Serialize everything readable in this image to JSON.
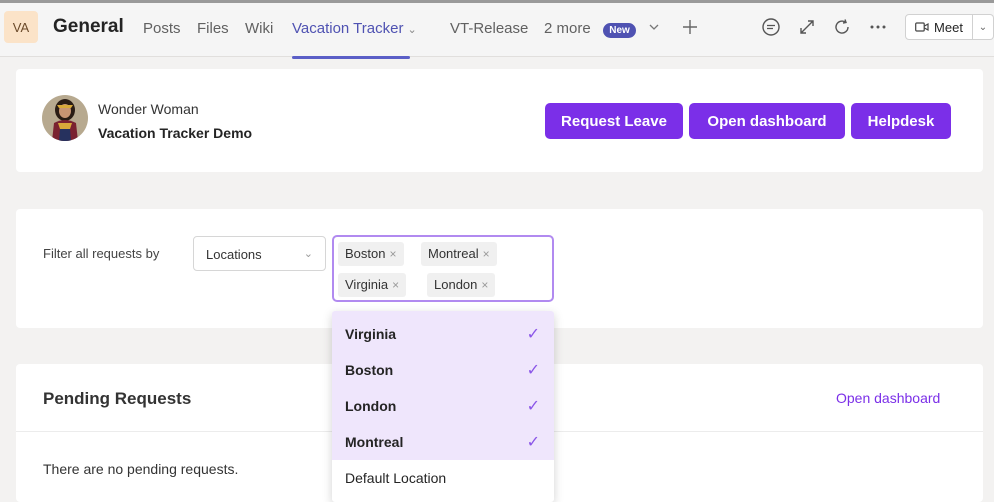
{
  "header": {
    "avatar_initials": "VA",
    "team_title": "General",
    "tabs": [
      {
        "label": "Posts"
      },
      {
        "label": "Files"
      },
      {
        "label": "Wiki"
      },
      {
        "label": "Vacation Tracker"
      },
      {
        "label": "VT-Release"
      },
      {
        "label": "2 more"
      }
    ],
    "new_badge": "New",
    "meet_label": "Meet"
  },
  "profile": {
    "user_name": "Wonder Woman",
    "app_name": "Vacation Tracker Demo"
  },
  "actions": {
    "request_leave": "Request Leave",
    "open_dashboard": "Open dashboard",
    "helpdesk": "Helpdesk"
  },
  "filter": {
    "label": "Filter all requests by",
    "select_value": "Locations",
    "selected_tags": [
      "Boston",
      "Montreal",
      "Virginia",
      "London"
    ],
    "options": [
      {
        "label": "Virginia",
        "selected": true
      },
      {
        "label": "Boston",
        "selected": true
      },
      {
        "label": "London",
        "selected": true
      },
      {
        "label": "Montreal",
        "selected": true
      },
      {
        "label": "Default Location",
        "selected": false
      }
    ]
  },
  "pending": {
    "title": "Pending Requests",
    "open_dashboard_link": "Open dashboard",
    "empty_text": "There are no pending requests."
  },
  "colors": {
    "accent": "#7b2fe8",
    "tab_active": "#5b5fc7",
    "selected_option_bg": "#efe6fc"
  }
}
